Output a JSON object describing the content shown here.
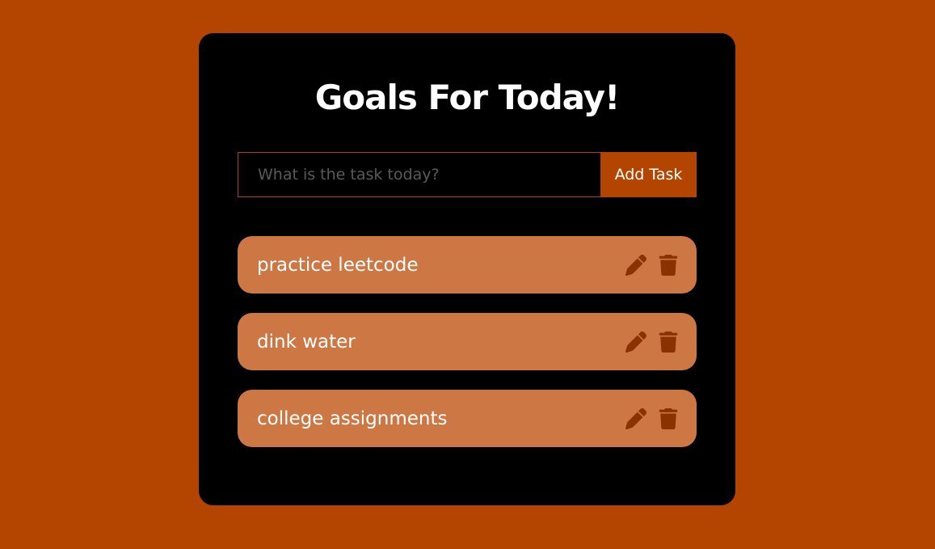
{
  "app": {
    "title": "Goals For Today!"
  },
  "form": {
    "input_value": "",
    "input_placeholder": "What is the task today?",
    "add_label": "Add Task"
  },
  "todos": [
    {
      "text": "practice leetcode",
      "edit_icon": "pencil-icon",
      "delete_icon": "trash-icon"
    },
    {
      "text": "dink water",
      "edit_icon": "pencil-icon",
      "delete_icon": "trash-icon"
    },
    {
      "text": "college assignments",
      "edit_icon": "pencil-icon",
      "delete_icon": "trash-icon"
    }
  ],
  "colors": {
    "background": "#b34500",
    "card": "#000000",
    "accent": "#b34500",
    "item": "#cc7744",
    "icon": "#8a3300",
    "text": "#ffffff"
  }
}
